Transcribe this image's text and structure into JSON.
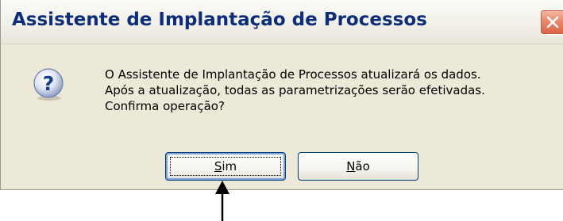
{
  "dialog": {
    "title": "Assistente de Implantação de Processos",
    "icon": "question-icon",
    "message_lines": [
      "O Assistente de Implantação de Processos atualizará os dados.",
      "Após a atualização, todas as parametrizações serão efetivadas.",
      "Confirma operação?"
    ],
    "buttons": {
      "yes": {
        "mnemonic": "S",
        "rest": "im"
      },
      "no": {
        "mnemonic": "N",
        "rest": "ão"
      }
    }
  },
  "colors": {
    "title_text": "#0c2e7a",
    "dialog_bg": "#ece9d8",
    "close_button": "#e2694b",
    "button_border": "#003c74"
  },
  "annotation": {
    "arrow_points_to": "yes-button",
    "icon": "up-arrow-icon"
  }
}
